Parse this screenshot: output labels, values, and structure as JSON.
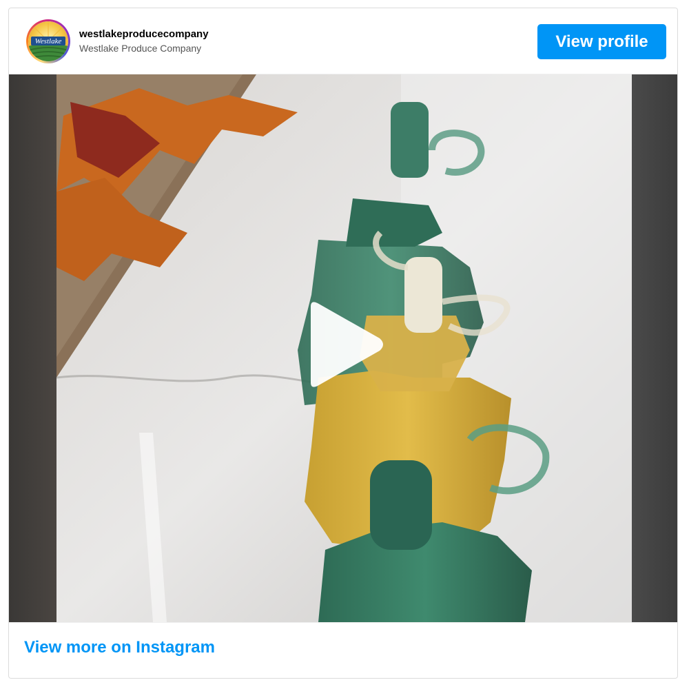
{
  "profile": {
    "username": "westlakeproducecompany",
    "full_name": "Westlake Produce Company",
    "logo_text": "Westlake",
    "view_profile_label": "View profile"
  },
  "media": {
    "type": "video",
    "play_icon": "play-icon"
  },
  "footer": {
    "view_more_label": "View more on Instagram"
  },
  "colors": {
    "accent": "#0095f6",
    "border": "#dbdbdb"
  }
}
